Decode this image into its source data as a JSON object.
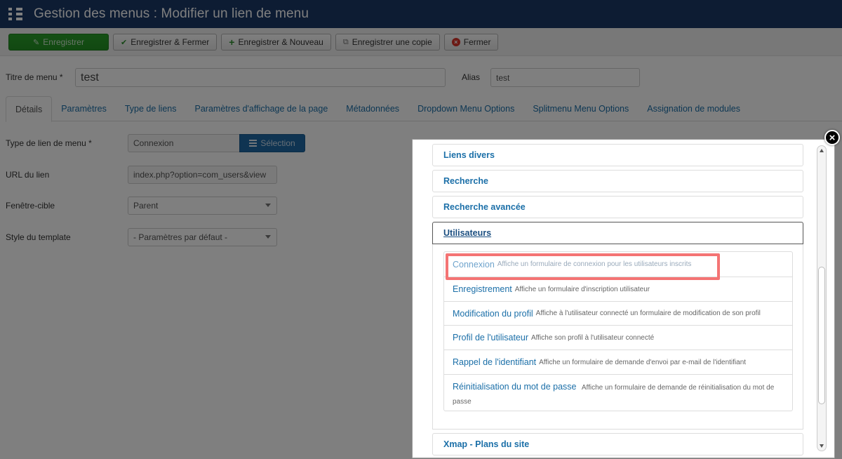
{
  "header": {
    "title": "Gestion des menus : Modifier un lien de menu",
    "icon": "list-icon"
  },
  "toolbar": {
    "save": "Enregistrer",
    "save_close": "Enregistrer & Fermer",
    "save_new": "Enregistrer & Nouveau",
    "save_copy": "Enregistrer une copie",
    "close": "Fermer"
  },
  "title_row": {
    "title_label": "Titre de menu *",
    "title_value": "test",
    "alias_label": "Alias",
    "alias_value": "test"
  },
  "tabs": [
    {
      "label": "Détails",
      "active": true
    },
    {
      "label": "Paramètres"
    },
    {
      "label": "Type de liens"
    },
    {
      "label": "Paramètres d'affichage de la page"
    },
    {
      "label": "Métadonnées"
    },
    {
      "label": "Dropdown Menu Options"
    },
    {
      "label": "Splitmenu Menu Options"
    },
    {
      "label": "Assignation de modules"
    }
  ],
  "form": {
    "type_label": "Type de lien de menu *",
    "type_value": "Connexion",
    "select_button": "Sélection",
    "url_label": "URL du lien",
    "url_value": "index.php?option=com_users&view",
    "target_label": "Fenêtre-cible",
    "target_value": "Parent",
    "style_label": "Style du template",
    "style_value": "- Paramètres par défaut -"
  },
  "modal": {
    "sections": [
      "Liens divers",
      "Recherche",
      "Recherche avancée",
      "Utilisateurs",
      "Xmap - Plans du site"
    ],
    "open_section": "Utilisateurs",
    "items": [
      {
        "title": "Connexion",
        "desc": "Affiche un formulaire de connexion pour les utilisateurs inscrits"
      },
      {
        "title": "Enregistrement",
        "desc": "Affiche un formulaire d'inscription utilisateur"
      },
      {
        "title": "Modification du profil",
        "desc": "Affiche à l'utilisateur connecté un formulaire de modification de son profil"
      },
      {
        "title": "Profil de l'utilisateur",
        "desc": "Affiche son profil à l'utilisateur connecté"
      },
      {
        "title": "Rappel de l'identifiant",
        "desc": "Affiche un formulaire de demande d'envoi par e-mail de l'identifiant"
      },
      {
        "title": "Réinitialisation du mot de passe",
        "desc": "Affiche un formulaire de demande de réinitialisation du mot de passe"
      }
    ],
    "close_glyph": "×"
  },
  "colors": {
    "header_bg": "#1a3867",
    "primary_green": "#239123",
    "link_blue": "#1b6fa8",
    "highlight_red": "#f47474"
  }
}
